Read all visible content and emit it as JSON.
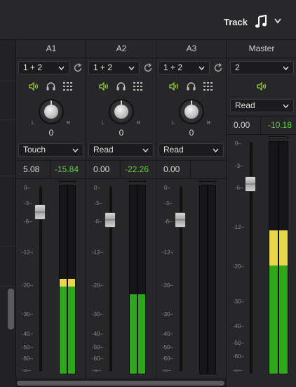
{
  "topbar": {
    "track_label": "Track"
  },
  "channels": [
    {
      "name": "A1",
      "bus": "1 + 2",
      "pan": "0",
      "automation": "Touch",
      "volume": "5.08",
      "peak": "-15.84",
      "fader_db": -6,
      "meter_green": 0.5,
      "meter_yellow": 0.04
    },
    {
      "name": "A2",
      "bus": "1 + 2",
      "pan": "0",
      "automation": "Read",
      "volume": "0.00",
      "peak": "-22.26",
      "fader_db": -6,
      "meter_green": 0.42,
      "meter_yellow": 0
    },
    {
      "name": "A3",
      "bus": "1 + 2",
      "pan": "0",
      "automation": "Read",
      "volume": "0.00",
      "peak": "",
      "fader_db": -6,
      "meter_green": 0,
      "meter_yellow": 0
    }
  ],
  "master": {
    "name": "Master",
    "bus": "2",
    "automation": "Read",
    "volume": "0.00",
    "peak": "-10.18",
    "meter_green": 0.45,
    "meter_yellow": 0.15
  },
  "scale_labels": [
    "0–",
    "-3–",
    "-6–",
    "-12–",
    "-20–",
    "-30–",
    "-40–",
    "-50–",
    "-60–",
    "-∞–"
  ],
  "pan_labels": {
    "left": "L",
    "right": "R"
  },
  "icons": [
    "music-note-icon",
    "chevron-down-icon",
    "reset-icon",
    "speaker-icon",
    "headphones-icon",
    "grid-icon"
  ]
}
